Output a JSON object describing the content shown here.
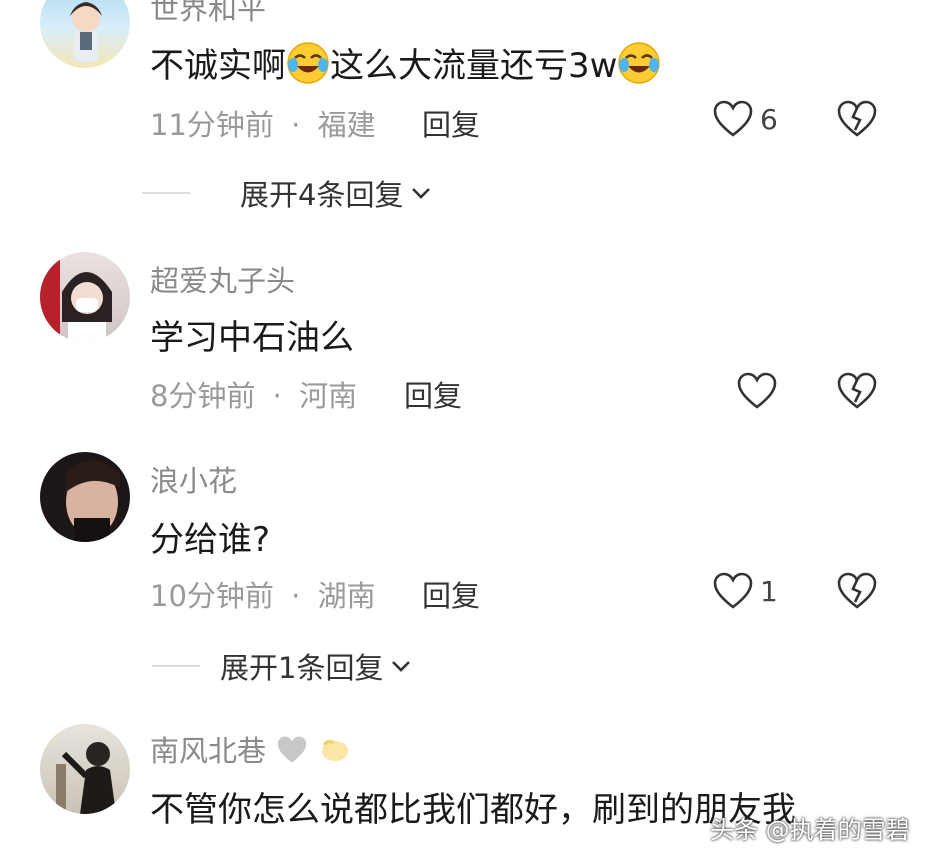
{
  "comments": [
    {
      "username": "世界和平",
      "content_a": "不诚实啊",
      "content_b": "这么大流量还亏3w",
      "time": "11分钟前",
      "sep": "·",
      "location": "福建",
      "reply_label": "回复",
      "likes": "6",
      "expand_label": "展开4条回复"
    },
    {
      "username": "超爱丸子头",
      "content": "学习中石油么",
      "time": "8分钟前",
      "sep": "·",
      "location": "河南",
      "reply_label": "回复",
      "likes": ""
    },
    {
      "username": "浪小花",
      "content": "分给谁?",
      "time": "10分钟前",
      "sep": "·",
      "location": "湖南",
      "reply_label": "回复",
      "likes": "1",
      "expand_label": "展开1条回复"
    },
    {
      "username": "南风北巷",
      "content": "不管你怎么说都比我们都好，刷到的朋友我"
    }
  ],
  "watermark": "头条 @执着的雪碧",
  "icons": {
    "like": "heart-outline-icon",
    "dislike": "broken-heart-icon",
    "expand": "chevron-down-icon",
    "emoji": "crying-laughing-emoji"
  },
  "colors": {
    "text": "#1a1a1a",
    "meta": "#9a9a9a",
    "username": "#8a8a8a"
  }
}
